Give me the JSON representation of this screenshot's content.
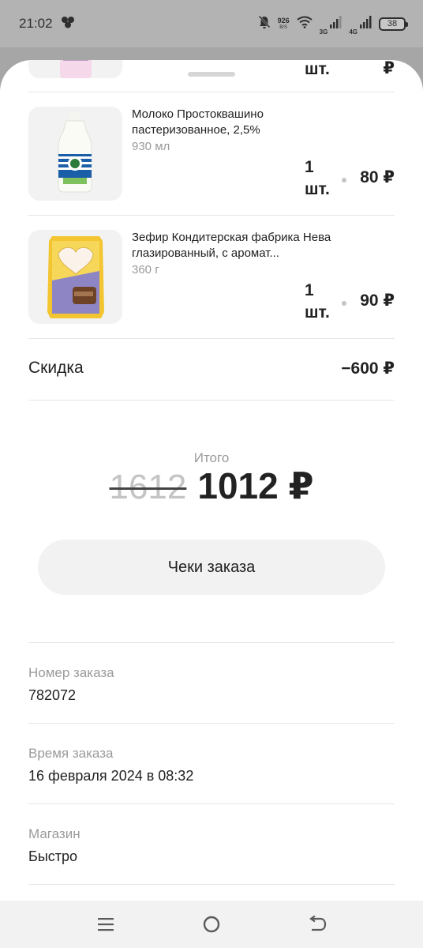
{
  "status_bar": {
    "time": "21:02",
    "net_speed_value": "926",
    "net_speed_unit": "B/S",
    "signal1_label": "3G",
    "signal2_label": "4G",
    "battery": "38"
  },
  "items": [
    {
      "partial_qty": "шт.",
      "partial_currency": "₽"
    },
    {
      "name": "Молоко Простоквашино пастеризованное, 2,5%",
      "volume": "930 мл",
      "qty_count": "1",
      "qty_unit": "шт.",
      "price": "80 ₽"
    },
    {
      "name": "Зефир Кондитерская фабрика Нева глазированный, с аромат...",
      "volume": "360 г",
      "qty_count": "1",
      "qty_unit": "шт.",
      "price": "90 ₽"
    }
  ],
  "discount": {
    "label": "Скидка",
    "value": "−600 ₽"
  },
  "total": {
    "label": "Итого",
    "old_value": "1612",
    "new_value": "1012 ₽"
  },
  "receipts_button": "Чеки заказа",
  "order_info": [
    {
      "label": "Номер заказа",
      "value": "782072"
    },
    {
      "label": "Время заказа",
      "value": "16 февраля 2024 в 08:32"
    },
    {
      "label": "Магазин",
      "value": "Быстро"
    }
  ],
  "colors": {
    "backdrop": "#a6a6a6",
    "sheet": "#ffffff",
    "button_bg": "#f2f2f2",
    "muted_text": "#9a9a9a"
  }
}
